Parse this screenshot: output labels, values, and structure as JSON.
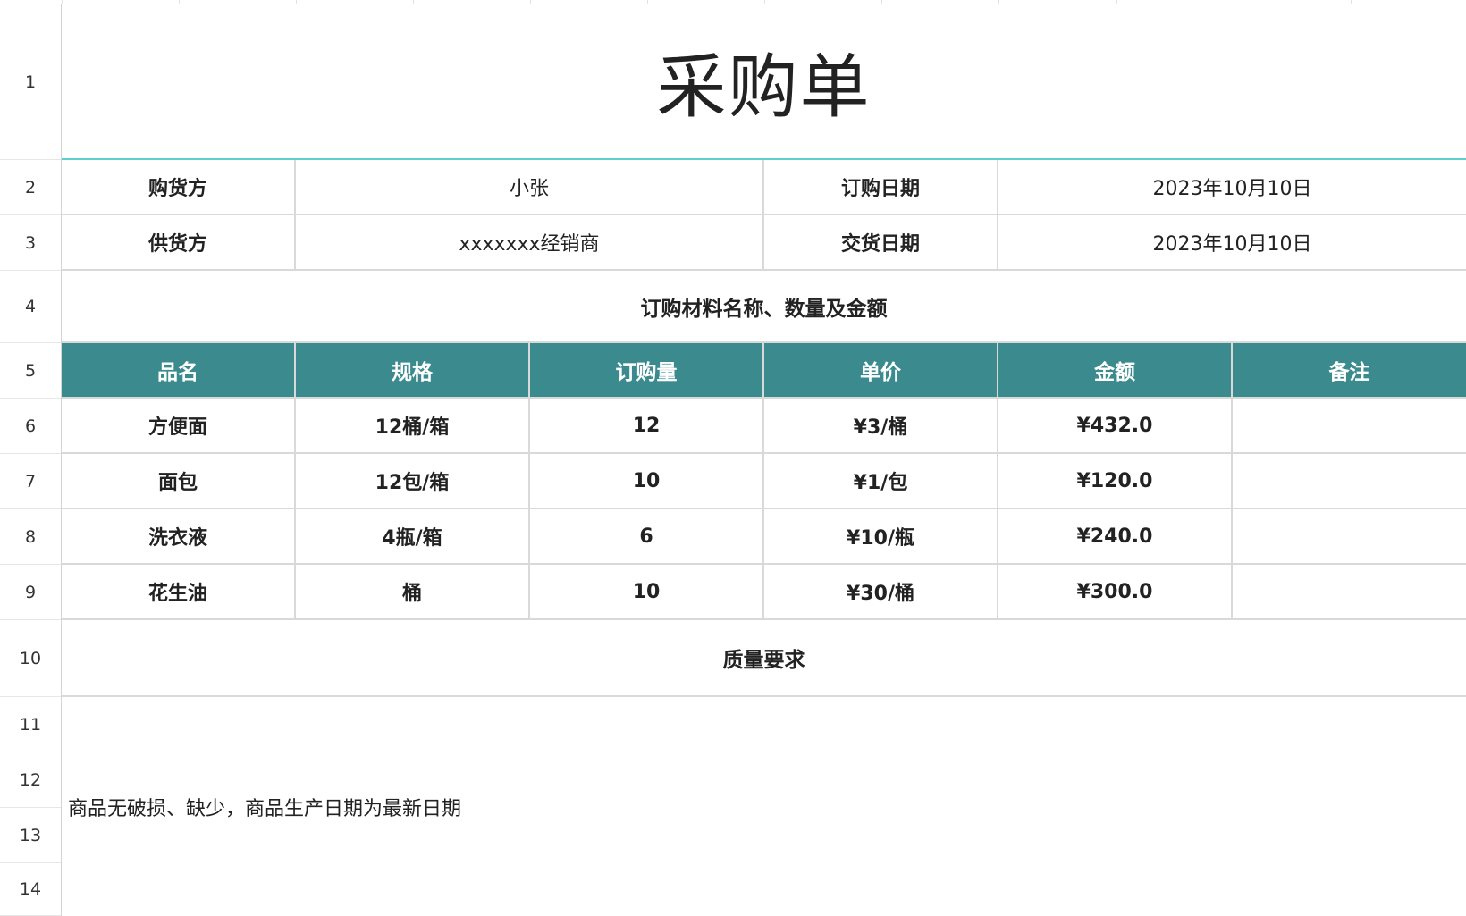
{
  "title": "采购单",
  "row_numbers": [
    "1",
    "2",
    "3",
    "4",
    "5",
    "6",
    "7",
    "8",
    "9",
    "10",
    "11",
    "12",
    "13",
    "14"
  ],
  "info": {
    "buyer_label": "购货方",
    "buyer_value": "小张",
    "order_date_label": "订购日期",
    "order_date_value": "2023年10月10日",
    "supplier_label": "供货方",
    "supplier_value": "xxxxxxx经销商",
    "delivery_date_label": "交货日期",
    "delivery_date_value": "2023年10月10日"
  },
  "materials_section": "订购材料名称、数量及金额",
  "table": {
    "headers": [
      "品名",
      "规格",
      "订购量",
      "单价",
      "金额",
      "备注"
    ],
    "rows": [
      [
        "方便面",
        "12桶/箱",
        "12",
        "¥3/桶",
        "¥432.0",
        ""
      ],
      [
        "面包",
        "12包/箱",
        "10",
        "¥1/包",
        "¥120.0",
        ""
      ],
      [
        "洗衣液",
        "4瓶/箱",
        "6",
        "¥10/瓶",
        "¥240.0",
        ""
      ],
      [
        "花生油",
        "桶",
        "10",
        "¥30/桶",
        "¥300.0",
        ""
      ]
    ]
  },
  "quality_section": "质量要求",
  "quality_note": "商品无破损、缺少，商品生产日期为最新日期",
  "colors": {
    "header_fill": "#3b8b8e",
    "title_underline": "#5ccfcf"
  }
}
